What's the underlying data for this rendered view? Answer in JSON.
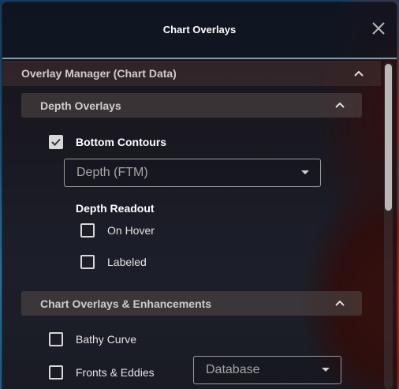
{
  "dialog": {
    "title": "Chart Overlays"
  },
  "overlay_manager": {
    "label": "Overlay Manager (Chart Data)",
    "expanded": true
  },
  "depth_overlays": {
    "label": "Depth Overlays",
    "expanded": true,
    "bottom_contours": {
      "label": "Bottom Contours",
      "checked": true
    },
    "depth_unit_select": {
      "value": "Depth (FTM)"
    },
    "depth_readout": {
      "label": "Depth Readout",
      "on_hover": {
        "label": "On Hover",
        "checked": false
      },
      "labeled": {
        "label": "Labeled",
        "checked": false
      }
    }
  },
  "chart_overlays": {
    "label": "Chart Overlays & Enhancements",
    "expanded": true,
    "bathy_curve": {
      "label": "Bathy Curve",
      "checked": false
    },
    "fronts_eddies": {
      "label": "Fronts & Eddies",
      "checked": false
    },
    "fronts_source_select": {
      "value": "Database"
    }
  },
  "colors": {
    "checkbox_border": "#d8d8d8",
    "header_divider": "#8a9aa8"
  }
}
